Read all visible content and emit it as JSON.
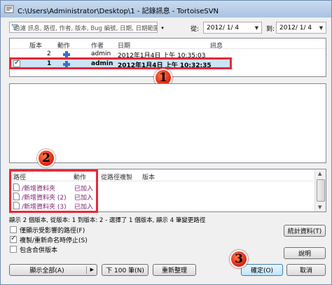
{
  "window": {
    "title": "C:\\Users\\Administrator\\Desktop\\1 - 記錄訊息 - TortoiseSVN"
  },
  "filter": {
    "placeholder": "過濾 訊息, 路徑, 作者, 版本, Bug 編號, 日期, 日期範圍",
    "from_label": "從:",
    "from_value": "2012/ 1/ 4",
    "to_label": "到:",
    "to_value": "2012/ 1/ 4"
  },
  "revisions": {
    "columns": [
      "版本",
      "動作",
      "作者",
      "日期",
      "訊息"
    ],
    "rows": [
      {
        "revision": "2",
        "author": "admin",
        "date": "2012年1月4日 上午 10:35:03",
        "message": ""
      },
      {
        "revision": "1",
        "author": "admin",
        "date": "2012年1月4日 上午 10:32:35",
        "message": ""
      }
    ]
  },
  "paths": {
    "columns": [
      "路徑",
      "動作",
      "從路徑複製",
      "版本"
    ],
    "rows": [
      {
        "path": "/新增資料夾",
        "action": "已加入"
      },
      {
        "path": "/新增資料夾 (2)",
        "action": "已加入"
      },
      {
        "path": "/新增資料夾 (3)",
        "action": "已加入"
      }
    ]
  },
  "status_text": "顯示 2 個版本, 從版本: 1 到版本: 2 - 選擇了 1 個版本, 顯示 4 筆變更路徑",
  "options": {
    "affected_paths": "僅顯示受影響的路徑(F)",
    "stop_on_copy": "複製/重新命名時停止(S)",
    "include_merged": "包含合併版本"
  },
  "buttons": {
    "statistics": "統計資料(T)",
    "help": "說明",
    "show_all": "顯示全部(A)",
    "next_100": "下 100 筆(N)",
    "refresh": "重新整理",
    "ok": "確定(O)",
    "cancel": "取消"
  },
  "annotations": {
    "marker1": "1",
    "marker2": "2",
    "marker3": "3"
  },
  "colors": {
    "annotation_red": "#e8283a",
    "path_text": "#7a1d6e",
    "selection": "#cde3f7"
  }
}
